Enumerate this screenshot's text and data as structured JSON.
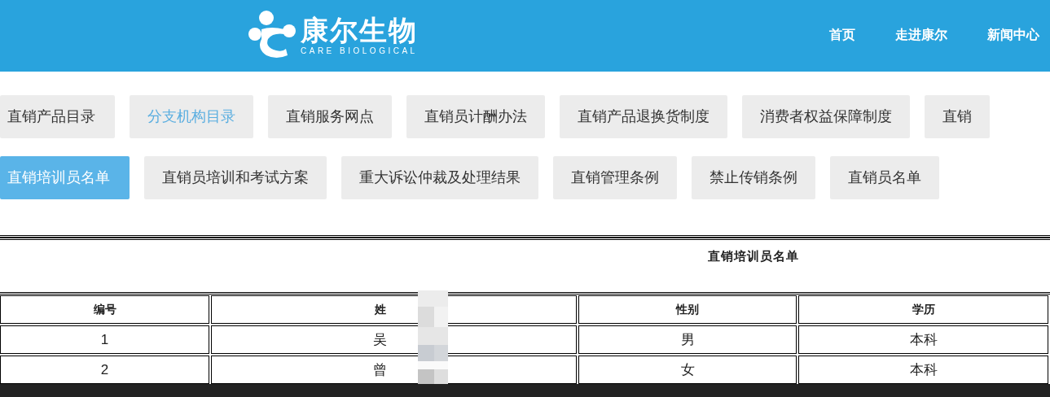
{
  "header": {
    "logo": {
      "name": "康尔生物",
      "subtitle": "CARE BIOLOGICAL"
    },
    "nav": [
      "首页",
      "走进康尔",
      "新闻中心"
    ]
  },
  "tab_rows": [
    [
      {
        "label": "直销产品目录",
        "selected": false,
        "highlighted": false
      },
      {
        "label": "分支机构目录",
        "selected": false,
        "highlighted": true
      },
      {
        "label": "直销服务网点",
        "selected": false,
        "highlighted": false
      },
      {
        "label": "直销员计酬办法",
        "selected": false,
        "highlighted": false
      },
      {
        "label": "直销产品退换货制度",
        "selected": false,
        "highlighted": false
      },
      {
        "label": "消费者权益保障制度",
        "selected": false,
        "highlighted": false
      },
      {
        "label": "直销",
        "selected": false,
        "highlighted": false
      }
    ],
    [
      {
        "label": "直销培训员名单",
        "selected": true,
        "highlighted": false
      },
      {
        "label": "直销员培训和考试方案",
        "selected": false,
        "highlighted": false
      },
      {
        "label": "重大诉讼仲裁及处理结果",
        "selected": false,
        "highlighted": false
      },
      {
        "label": "直销管理条例",
        "selected": false,
        "highlighted": false
      },
      {
        "label": "禁止传销条例",
        "selected": false,
        "highlighted": false
      },
      {
        "label": "直销员名单",
        "selected": false,
        "highlighted": false
      }
    ]
  ],
  "table": {
    "title": "直销培训员名单",
    "columns": [
      "编号",
      "姓",
      "性别",
      "学历"
    ],
    "rows": [
      [
        "1",
        "吴",
        "男",
        "本科"
      ],
      [
        "2",
        "曾",
        "女",
        "本科"
      ]
    ]
  }
}
